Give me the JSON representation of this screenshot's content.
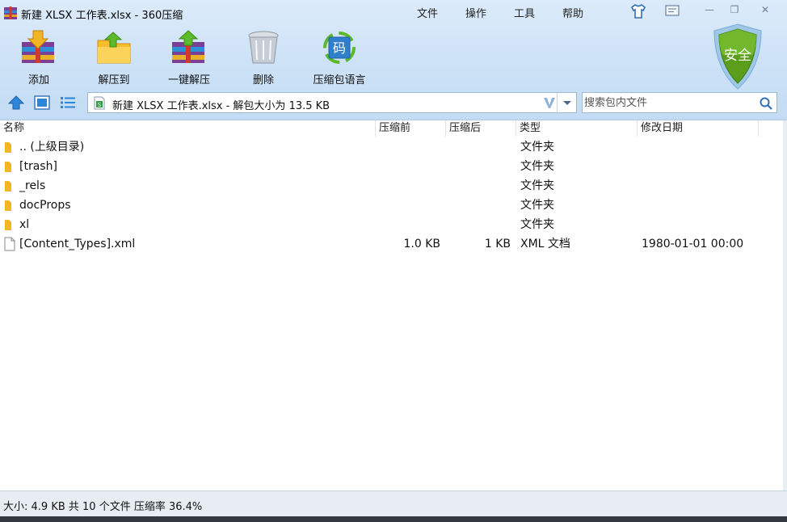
{
  "window": {
    "title": "新建 XLSX 工作表.xlsx - 360压缩"
  },
  "menu": {
    "items": [
      "文件",
      "操作",
      "工具",
      "帮助"
    ]
  },
  "window_controls": {
    "skin_icon": "tshirt-icon",
    "feedback_icon": "message-icon",
    "minimize": "—",
    "maximize": "❐",
    "close": "✕"
  },
  "toolbar": {
    "add_label": "添加",
    "extract_to_label": "解压到",
    "one_click_extract_label": "一键解压",
    "delete_label": "删除",
    "archive_language_label": "压缩包语言",
    "archive_language_glyph": "码"
  },
  "shield": {
    "label": "安全"
  },
  "address": {
    "path_text": "新建 XLSX 工作表.xlsx - 解包大小为 13.5 KB",
    "search_placeholder": "搜索包内文件"
  },
  "columns": {
    "name": "名称",
    "packed": "压缩前",
    "compressed": "压缩后",
    "type": "类型",
    "modified": "修改日期"
  },
  "files": [
    {
      "name": ".. (上级目录)",
      "packed": "",
      "compressed": "",
      "type": "文件夹",
      "modified": "",
      "icon": "folder-icon"
    },
    {
      "name": "[trash]",
      "packed": "",
      "compressed": "",
      "type": "文件夹",
      "modified": "",
      "icon": "folder-icon"
    },
    {
      "name": "_rels",
      "packed": "",
      "compressed": "",
      "type": "文件夹",
      "modified": "",
      "icon": "folder-icon"
    },
    {
      "name": "docProps",
      "packed": "",
      "compressed": "",
      "type": "文件夹",
      "modified": "",
      "icon": "folder-icon"
    },
    {
      "name": "xl",
      "packed": "",
      "compressed": "",
      "type": "文件夹",
      "modified": "",
      "icon": "folder-icon"
    },
    {
      "name": "[Content_Types].xml",
      "packed": "1.0 KB",
      "compressed": "1 KB",
      "type": "XML 文档",
      "modified": "1980-01-01 00:00",
      "icon": "file-icon"
    }
  ],
  "status": {
    "text": "大小: 4.9 KB 共 10 个文件 压缩率 36.4%"
  },
  "colors": {
    "chrome_top": "#dcebfa",
    "chrome_bottom": "#c3dcf4",
    "folder": "#f2b824",
    "shield_green": "#5a9e1c"
  }
}
